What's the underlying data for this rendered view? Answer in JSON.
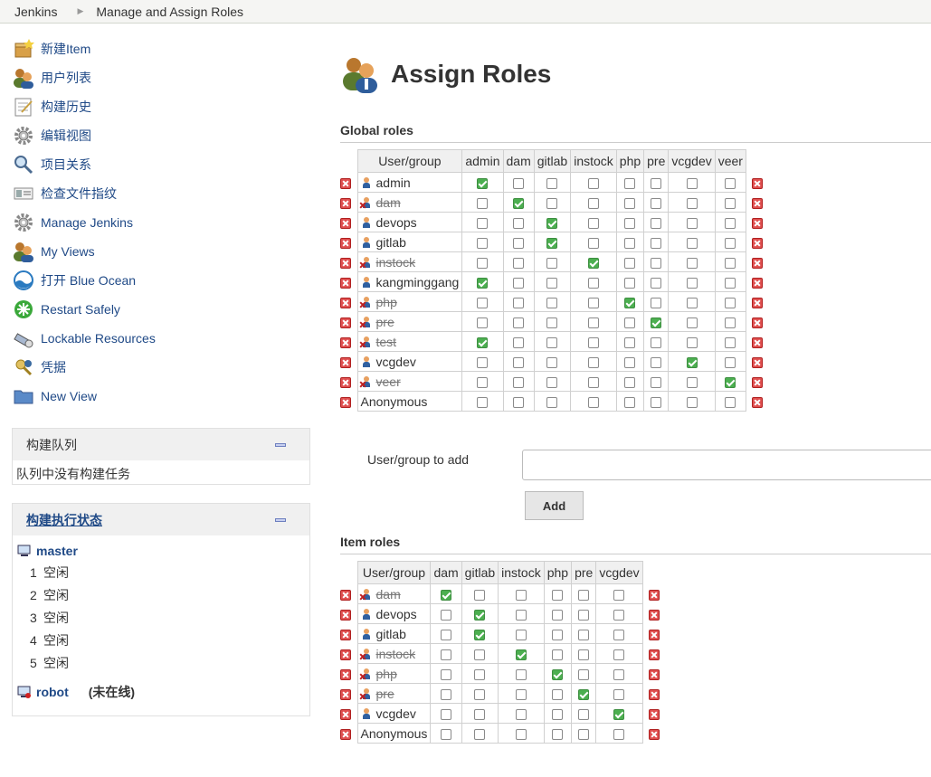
{
  "breadcrumb": {
    "root": "Jenkins",
    "current": "Manage and Assign Roles"
  },
  "sidebar": {
    "tasks": [
      {
        "label": "新建Item",
        "icon": "new-item-icon"
      },
      {
        "label": "用户列表",
        "icon": "users-icon"
      },
      {
        "label": "构建历史",
        "icon": "notepad-icon"
      },
      {
        "label": "编辑视图",
        "icon": "gear-icon"
      },
      {
        "label": "项目关系",
        "icon": "magnifier-icon"
      },
      {
        "label": "检查文件指纹",
        "icon": "fingerprint-icon"
      },
      {
        "label": "Manage Jenkins",
        "icon": "gear-icon"
      },
      {
        "label": "My Views",
        "icon": "users-icon"
      },
      {
        "label": "打开 Blue Ocean",
        "icon": "blue-ocean-icon"
      },
      {
        "label": "Restart Safely",
        "icon": "restart-icon"
      },
      {
        "label": "Lockable Resources",
        "icon": "lock-resource-icon"
      },
      {
        "label": "凭据",
        "icon": "credentials-icon"
      },
      {
        "label": "New View",
        "icon": "folder-icon"
      }
    ]
  },
  "queue": {
    "title": "构建队列",
    "empty_text": "队列中没有构建任务"
  },
  "executors": {
    "title": "构建执行状态",
    "nodes": [
      {
        "name": "master",
        "status": "",
        "executors": [
          {
            "num": "1",
            "state": "空闲"
          },
          {
            "num": "2",
            "state": "空闲"
          },
          {
            "num": "3",
            "state": "空闲"
          },
          {
            "num": "4",
            "state": "空闲"
          },
          {
            "num": "5",
            "state": "空闲"
          }
        ]
      },
      {
        "name": "robot",
        "status": "(未在线)",
        "executors": []
      }
    ]
  },
  "page_title": "Assign Roles",
  "global_roles": {
    "title": "Global roles",
    "header": "User/group",
    "columns": [
      "admin",
      "dam",
      "gitlab",
      "instock",
      "php",
      "pre",
      "vcgdev",
      "veer"
    ],
    "rows": [
      {
        "name": "admin",
        "missing": false,
        "icon": true,
        "checks": [
          1,
          0,
          0,
          0,
          0,
          0,
          0,
          0
        ]
      },
      {
        "name": "dam",
        "missing": true,
        "icon": true,
        "checks": [
          0,
          1,
          0,
          0,
          0,
          0,
          0,
          0
        ]
      },
      {
        "name": "devops",
        "missing": false,
        "icon": true,
        "checks": [
          0,
          0,
          1,
          0,
          0,
          0,
          0,
          0
        ]
      },
      {
        "name": "gitlab",
        "missing": false,
        "icon": true,
        "checks": [
          0,
          0,
          1,
          0,
          0,
          0,
          0,
          0
        ]
      },
      {
        "name": "instock",
        "missing": true,
        "icon": true,
        "checks": [
          0,
          0,
          0,
          1,
          0,
          0,
          0,
          0
        ]
      },
      {
        "name": "kangminggang",
        "missing": false,
        "icon": true,
        "checks": [
          1,
          0,
          0,
          0,
          0,
          0,
          0,
          0
        ]
      },
      {
        "name": "php",
        "missing": true,
        "icon": true,
        "checks": [
          0,
          0,
          0,
          0,
          1,
          0,
          0,
          0
        ]
      },
      {
        "name": "pre",
        "missing": true,
        "icon": true,
        "checks": [
          0,
          0,
          0,
          0,
          0,
          1,
          0,
          0
        ]
      },
      {
        "name": "test",
        "missing": true,
        "icon": true,
        "checks": [
          1,
          0,
          0,
          0,
          0,
          0,
          0,
          0
        ]
      },
      {
        "name": "vcgdev",
        "missing": false,
        "icon": true,
        "checks": [
          0,
          0,
          0,
          0,
          0,
          0,
          1,
          0
        ]
      },
      {
        "name": "veer",
        "missing": true,
        "icon": true,
        "checks": [
          0,
          0,
          0,
          0,
          0,
          0,
          0,
          1
        ]
      },
      {
        "name": "Anonymous",
        "missing": false,
        "icon": false,
        "checks": [
          0,
          0,
          0,
          0,
          0,
          0,
          0,
          0
        ]
      }
    ]
  },
  "add_user": {
    "label": "User/group to add",
    "value": "",
    "button": "Add"
  },
  "item_roles": {
    "title": "Item roles",
    "header": "User/group",
    "columns": [
      "dam",
      "gitlab",
      "instock",
      "php",
      "pre",
      "vcgdev"
    ],
    "rows": [
      {
        "name": "dam",
        "missing": true,
        "icon": true,
        "checks": [
          1,
          0,
          0,
          0,
          0,
          0
        ]
      },
      {
        "name": "devops",
        "missing": false,
        "icon": true,
        "checks": [
          0,
          1,
          0,
          0,
          0,
          0
        ]
      },
      {
        "name": "gitlab",
        "missing": false,
        "icon": true,
        "checks": [
          0,
          1,
          0,
          0,
          0,
          0
        ]
      },
      {
        "name": "instock",
        "missing": true,
        "icon": true,
        "checks": [
          0,
          0,
          1,
          0,
          0,
          0
        ]
      },
      {
        "name": "php",
        "missing": true,
        "icon": true,
        "checks": [
          0,
          0,
          0,
          1,
          0,
          0
        ]
      },
      {
        "name": "pre",
        "missing": true,
        "icon": true,
        "checks": [
          0,
          0,
          0,
          0,
          1,
          0
        ]
      },
      {
        "name": "vcgdev",
        "missing": false,
        "icon": true,
        "checks": [
          0,
          0,
          0,
          0,
          0,
          1
        ]
      },
      {
        "name": "Anonymous",
        "missing": false,
        "icon": false,
        "checks": [
          0,
          0,
          0,
          0,
          0,
          0
        ]
      }
    ]
  }
}
